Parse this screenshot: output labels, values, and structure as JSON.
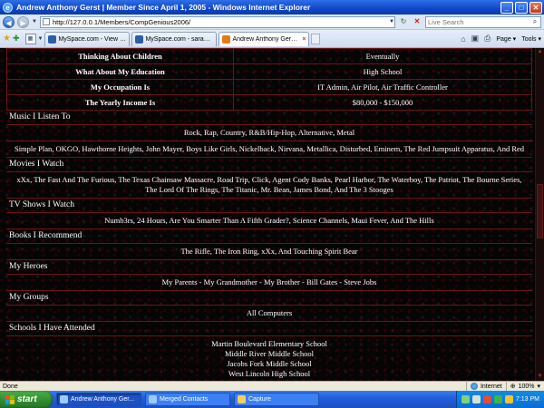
{
  "window": {
    "title": "Andrew Anthony Gerst | Member Since April 1, 2005 - Windows Internet Explorer",
    "controls": {
      "minimize": "_",
      "maximize": "□",
      "close": "✕"
    }
  },
  "address_bar": {
    "url": "http://127.0.0.1/Members/CompGenious2006/",
    "search_placeholder": "Live Search"
  },
  "tabs": [
    {
      "label": "MySpace.com - View Image -...",
      "active": false
    },
    {
      "label": "MySpace.com - sarah@marie...",
      "active": false
    },
    {
      "label": "Andrew Anthony Gerst | ...",
      "active": true
    }
  ],
  "command_bar": {
    "page": "Page",
    "tools": "Tools"
  },
  "profile": {
    "details": [
      {
        "key": "Thinking About Children",
        "value": "Eventually"
      },
      {
        "key": "What About My Education",
        "value": "High School"
      },
      {
        "key": "My Occupation Is",
        "value": "IT Admin, Air Pilot, Air Traffic Controller"
      },
      {
        "key": "The Yearly Income Is",
        "value": "$80,000 - $150,000"
      }
    ],
    "music": {
      "heading": "Music I Listen To",
      "genres": "Rock, Rap, Country, R&B/Hip-Hop, Alternative, Metal",
      "bands": "Simple Plan, OKGO, Hawthorne Heights, John Mayer, Boys Like Girls, Nickelback, Nirvana, Metallica, Disturbed, Eminem, The Red Jumpsuit Apparatus, And Red"
    },
    "movies": {
      "heading": "Movies I Watch",
      "list": "xXx, The Fast And The Furious, The Texas Chainsaw Massacre, Road Trip, Click, Agent Cody Banks, Pearl Harbor, The Waterboy, The Patriot, The Bourne Series, The Lord Of The Rings, The Titanic, Mr. Bean, James Bond, And The 3 Stooges"
    },
    "tv": {
      "heading": "TV Shows I Watch",
      "list": "Numb3rs, 24 Hours, Are You Smarter Than A Fifth Grader?, Science Channels, Maui Fever, And The Hills"
    },
    "books": {
      "heading": "Books I Recommend",
      "list": "The Rifle, The Iron Ring, xXx, And Touching Spirit Bear"
    },
    "heroes": {
      "heading": "My Heroes",
      "list": "My Parents - My Grandmother - My Brother - Bill Gates - Steve Jobs"
    },
    "groups": {
      "heading": "My Groups",
      "list": "All Computers"
    },
    "schools": {
      "heading": "Schools I Have Attended",
      "list": [
        "Martin Boulevard Elementary School",
        "Middle River Middle School",
        "Jacobs Fork Middle School",
        "West Lincoln High School"
      ]
    }
  },
  "status_bar": {
    "text": "Done",
    "zone": "Internet",
    "zoom": "100%"
  },
  "taskbar": {
    "start_label": "start",
    "buttons": [
      {
        "label": "Andrew Anthony Ger...",
        "active": true
      },
      {
        "label": "Merged Contacts",
        "active": false
      },
      {
        "label": "Capture",
        "active": false
      }
    ],
    "clock": "7:13 PM"
  },
  "colors": {
    "page_background": "#050505",
    "border_red": "#6a1515",
    "taskbar_blue": "#245edb",
    "start_green": "#2e8b2e"
  }
}
